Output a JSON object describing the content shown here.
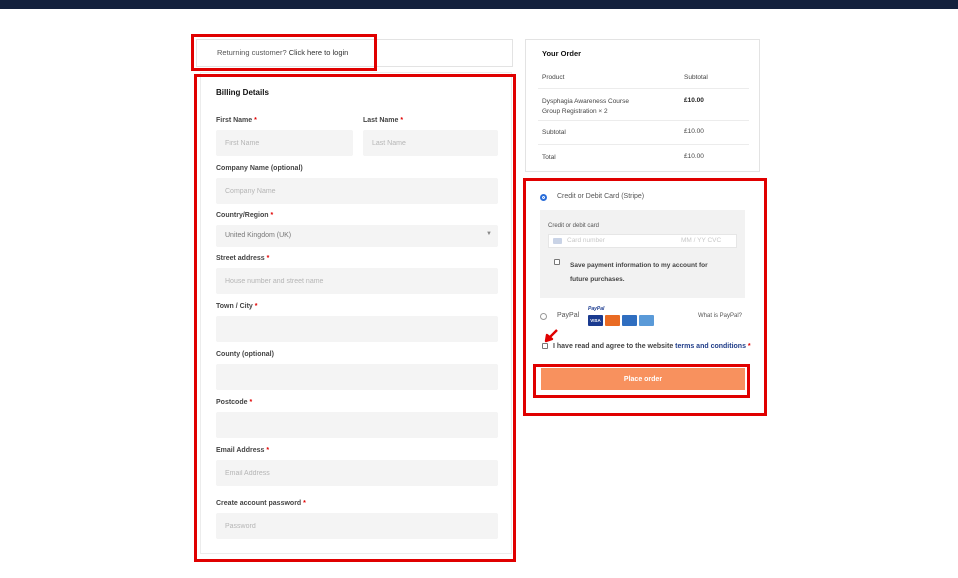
{
  "login_notice": {
    "prefix": "Returning customer?",
    "link": "Click here to login"
  },
  "billing": {
    "title": "Billing Details",
    "required_mark": "*",
    "first_name": {
      "label": "First Name",
      "placeholder": "First Name"
    },
    "last_name": {
      "label": "Last Name",
      "placeholder": "Last Name"
    },
    "company": {
      "label": "Company Name (optional)",
      "placeholder": "Company Name"
    },
    "country": {
      "label": "Country/Region",
      "value": "United Kingdom (UK)"
    },
    "street": {
      "label": "Street address",
      "placeholder": "House number and street name"
    },
    "town": {
      "label": "Town / City",
      "placeholder": ""
    },
    "county": {
      "label": "County (optional)",
      "placeholder": ""
    },
    "postcode": {
      "label": "Postcode",
      "placeholder": ""
    },
    "email": {
      "label": "Email Address",
      "placeholder": "Email Address"
    },
    "password": {
      "label": "Create account password",
      "placeholder": "Password"
    }
  },
  "order": {
    "title": "Your Order",
    "col_product": "Product",
    "col_subtotal": "Subtotal",
    "item_name_line1": "Dysphagia Awareness Course",
    "item_name_line2": "Group Registration",
    "item_qty": "× 2",
    "item_price": "£10.00",
    "subtotal_label": "Subtotal",
    "subtotal_value": "£10.00",
    "total_label": "Total",
    "total_value": "£10.00"
  },
  "payment": {
    "stripe_label": "Credit or Debit Card (Stripe)",
    "card_section_label": "Credit or debit card",
    "card_number_placeholder": "Card number",
    "card_expiry_placeholder": "MM / YY  CVC",
    "save_payment_line1": "Save payment information to my account for",
    "save_payment_line2": "future purchases.",
    "paypal_label": "PayPal",
    "paypal_logo_text": "PayPal",
    "what_is_paypal": "What is PayPal?",
    "terms_prefix": "I have read and agree to the website",
    "terms_link": "terms and conditions",
    "terms_required": "*",
    "place_order": "Place order"
  },
  "colors": {
    "accent_red": "#e00000",
    "button_orange": "#f8915e",
    "topbar_navy": "#14213d",
    "link_blue": "#1f3c88"
  }
}
